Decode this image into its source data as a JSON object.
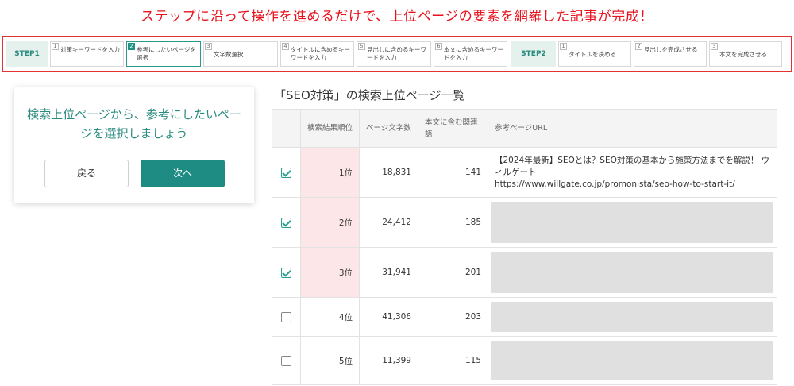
{
  "headline": "ステップに沿って操作を進めるだけで、上位ページの要素を網羅した記事が完成！",
  "stepbar": {
    "step1_label": "STEP1",
    "step2_label": "STEP2",
    "steps1": [
      {
        "num": "1",
        "label": "対策キーワードを入力"
      },
      {
        "num": "2",
        "label": "参考にしたいページを選択",
        "active": true
      },
      {
        "num": "3",
        "label": "文字数選択"
      },
      {
        "num": "4",
        "label": "タイトルに含めるキーワードを入力"
      },
      {
        "num": "5",
        "label": "見出しに含めるキーワードを入力"
      },
      {
        "num": "6",
        "label": "本文に含めるキーワードを入力"
      }
    ],
    "steps2": [
      {
        "num": "1",
        "label": "タイトルを決める"
      },
      {
        "num": "2",
        "label": "見出しを完成させる"
      },
      {
        "num": "3",
        "label": "本文を完成させる"
      }
    ]
  },
  "card": {
    "message": "検索上位ページから、参考にしたいページを選択しましょう",
    "back_label": "戻る",
    "next_label": "次へ"
  },
  "list": {
    "title": "「SEO対策」の検索上位ページ一覧",
    "headers": {
      "rank": "検索結果順位",
      "words": "ページ文字数",
      "related": "本文に含む関連語",
      "url": "参考ページURL"
    },
    "rows": [
      {
        "checked": true,
        "rank": "1位",
        "words": "18,831",
        "related": "141",
        "url_title": "【2024年最新】SEOとは？SEO対策の基本から施策方法までを解説！ ウィルゲート",
        "url": "https://www.willgate.co.jp/promonista/seo-how-to-start-it/"
      },
      {
        "checked": true,
        "rank": "2位",
        "words": "24,412",
        "related": "185"
      },
      {
        "checked": true,
        "rank": "3位",
        "words": "31,941",
        "related": "201"
      },
      {
        "checked": false,
        "rank": "4位",
        "words": "41,306",
        "related": "203"
      },
      {
        "checked": false,
        "rank": "5位",
        "words": "11,399",
        "related": "115"
      }
    ]
  }
}
